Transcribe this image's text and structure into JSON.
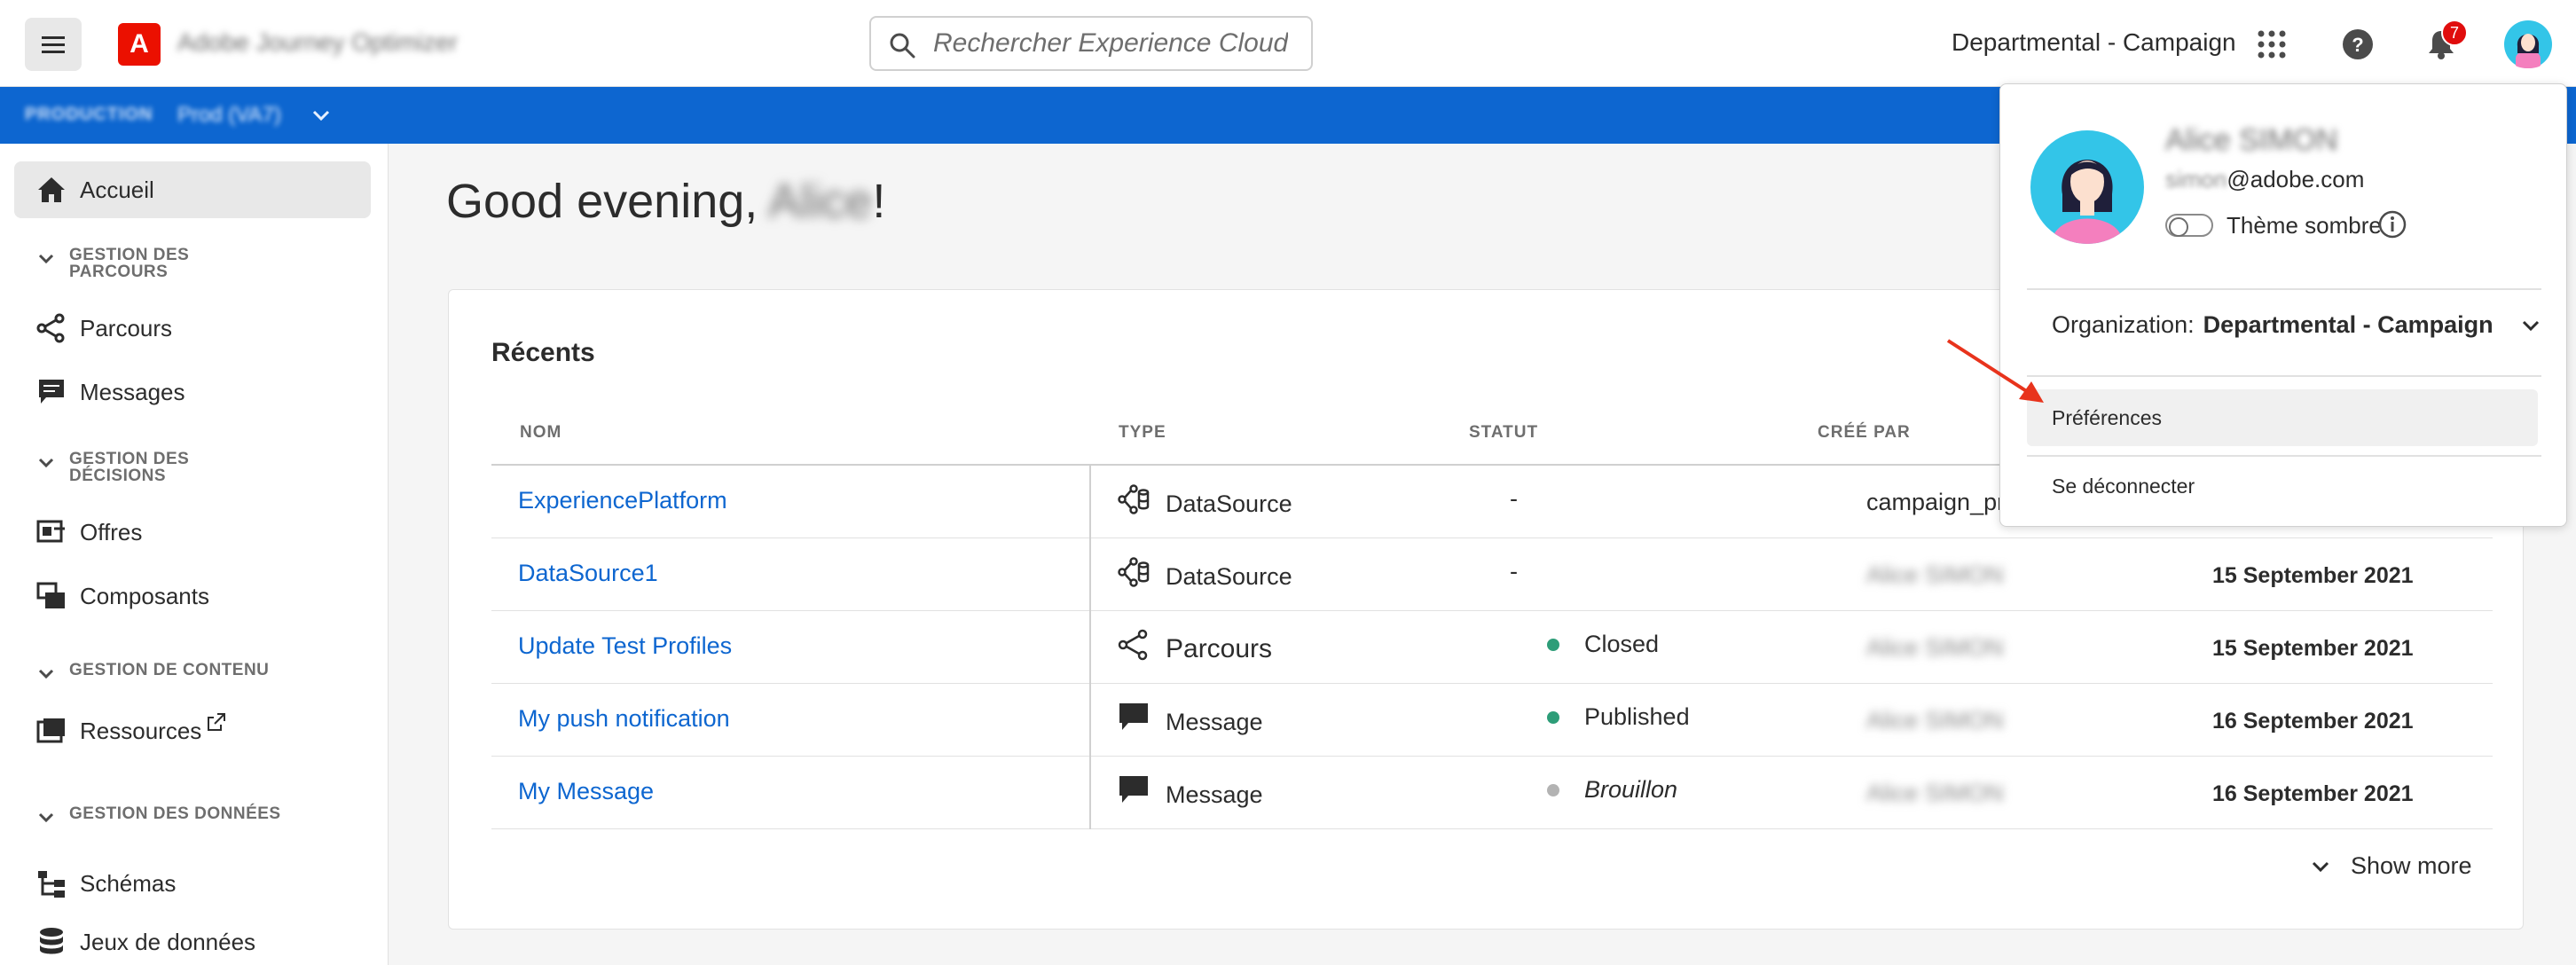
{
  "header": {
    "app_name": "Adobe Journey Optimizer",
    "search_placeholder": "Rechercher Experience Cloud",
    "org_name": "Departmental - Campaign",
    "notification_count": "7"
  },
  "context_bar": {
    "environment": "PRODUCTION",
    "sandbox": "Prod (VA7)"
  },
  "sidebar": {
    "home": "Accueil",
    "sections": [
      {
        "label": "GESTION DES PARCOURS",
        "items": [
          "Parcours",
          "Messages"
        ]
      },
      {
        "label": "GESTION DES DÉCISIONS",
        "items": [
          "Offres",
          "Composants"
        ]
      },
      {
        "label": "GESTION DE CONTENU",
        "items": [
          "Ressources"
        ]
      },
      {
        "label": "GESTION DES DONNÉES",
        "items": [
          "Schémas",
          "Jeux de données"
        ]
      }
    ]
  },
  "main": {
    "greeting_prefix": "Good evening, ",
    "greeting_name": "Alice",
    "greeting_suffix": "!"
  },
  "recents": {
    "title": "Récents",
    "columns": [
      "NOM",
      "TYPE",
      "STATUT",
      "CRÉÉ PAR"
    ],
    "rows": [
      {
        "name": "ExperiencePlatform",
        "type": "DataSource",
        "status": "-",
        "created_by": "campaign_provisi",
        "date": ""
      },
      {
        "name": "DataSource1",
        "type": "DataSource",
        "status": "-",
        "created_by": "Alice SIMON",
        "date": "15 September 2021"
      },
      {
        "name": "Update Test Profiles",
        "type": "Parcours",
        "status": "Closed",
        "created_by": "Alice SIMON",
        "date": "15 September 2021"
      },
      {
        "name": "My push notification",
        "type": "Message",
        "status": "Published",
        "created_by": "Alice SIMON",
        "date": "16 September 2021"
      },
      {
        "name": "My Message",
        "type": "Message",
        "status": "Brouillon",
        "created_by": "Alice SIMON",
        "date": "16 September 2021"
      }
    ],
    "show_more": "Show more"
  },
  "profile_popover": {
    "name": "Alice SIMON",
    "email_user": "simon",
    "email_domain": "@adobe.com",
    "dark_theme_label": "Thème sombre",
    "org_label": "Organization:",
    "org_value": "Departmental - Campaign",
    "preferences": "Préférences",
    "logout": "Se déconnecter"
  },
  "colors": {
    "brand_red": "#eb1000",
    "context_blue": "#0d66d0",
    "link_blue": "#0d66d0",
    "status_green": "#2d9d78",
    "status_grey": "#b3b3b3",
    "annotation_red": "#e8331c"
  }
}
